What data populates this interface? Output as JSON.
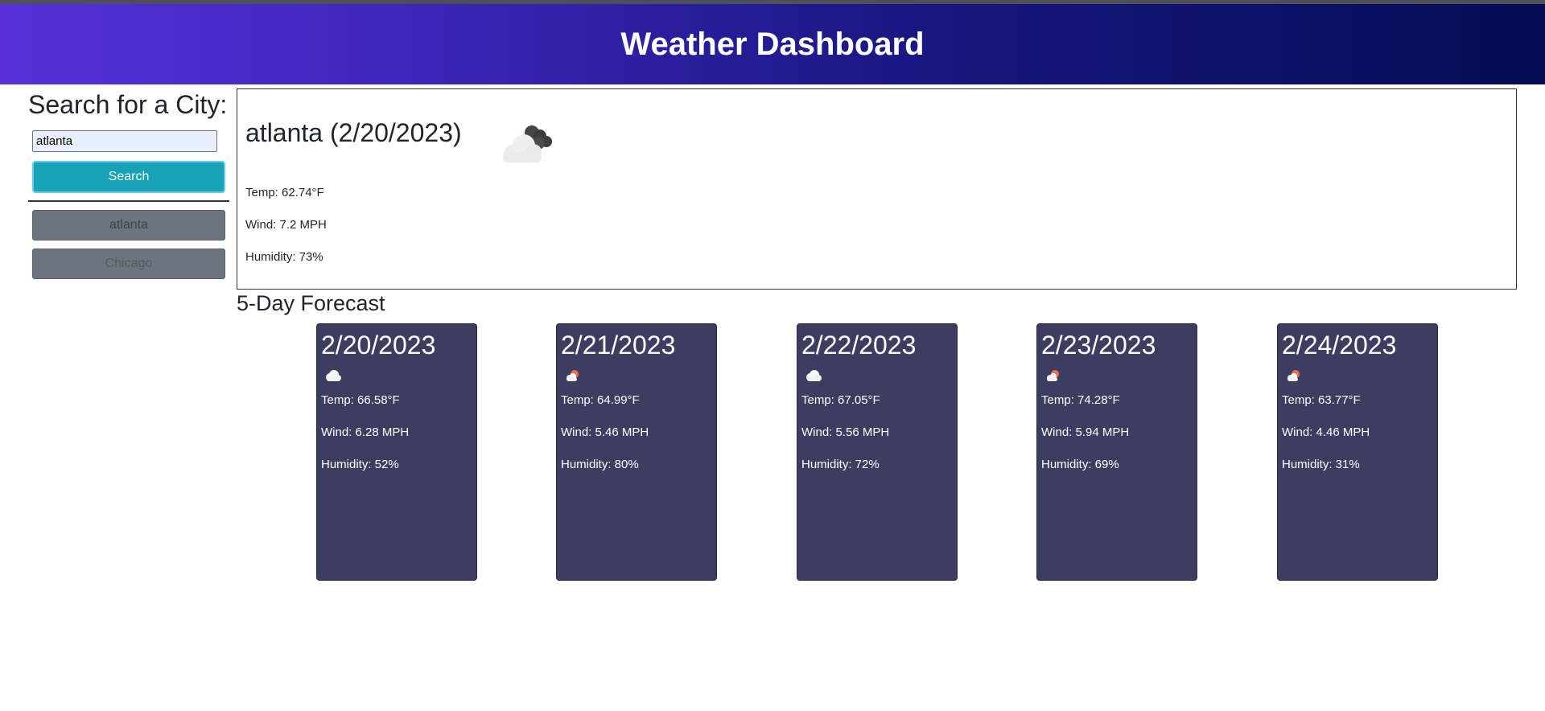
{
  "header": {
    "title": "Weather Dashboard"
  },
  "sidebar": {
    "heading": "Search for a City:",
    "search_value": "atlanta",
    "search_button": "Search",
    "history": [
      "atlanta",
      "Chicago"
    ]
  },
  "current": {
    "title": "atlanta (2/20/2023)",
    "icon": "cloudy-icon",
    "temp": "Temp: 62.74°F",
    "wind": "Wind: 7.2 MPH",
    "humidity": "Humidity: 73%"
  },
  "forecast": {
    "title": "5-Day Forecast",
    "days": [
      {
        "date": "2/20/2023",
        "icon": "cloud-icon",
        "temp": "Temp: 66.58°F",
        "wind": "Wind: 6.28 MPH",
        "humidity": "Humidity: 52%"
      },
      {
        "date": "2/21/2023",
        "icon": "sun-cloud-icon",
        "temp": "Temp: 64.99°F",
        "wind": "Wind: 5.46 MPH",
        "humidity": "Humidity: 80%"
      },
      {
        "date": "2/22/2023",
        "icon": "cloud-icon",
        "temp": "Temp: 67.05°F",
        "wind": "Wind: 5.56 MPH",
        "humidity": "Humidity: 72%"
      },
      {
        "date": "2/23/2023",
        "icon": "sun-cloud-icon",
        "temp": "Temp: 74.28°F",
        "wind": "Wind: 5.94 MPH",
        "humidity": "Humidity: 69%"
      },
      {
        "date": "2/24/2023",
        "icon": "sun-cloud-icon",
        "temp": "Temp: 63.77°F",
        "wind": "Wind: 4.46 MPH",
        "humidity": "Humidity: 31%"
      }
    ]
  },
  "colors": {
    "header_gradient_start": "#5730d9",
    "header_gradient_end": "#040c54",
    "search_button": "#17a2b8",
    "history_button": "#6c757d",
    "forecast_card": "#3d3d61"
  }
}
